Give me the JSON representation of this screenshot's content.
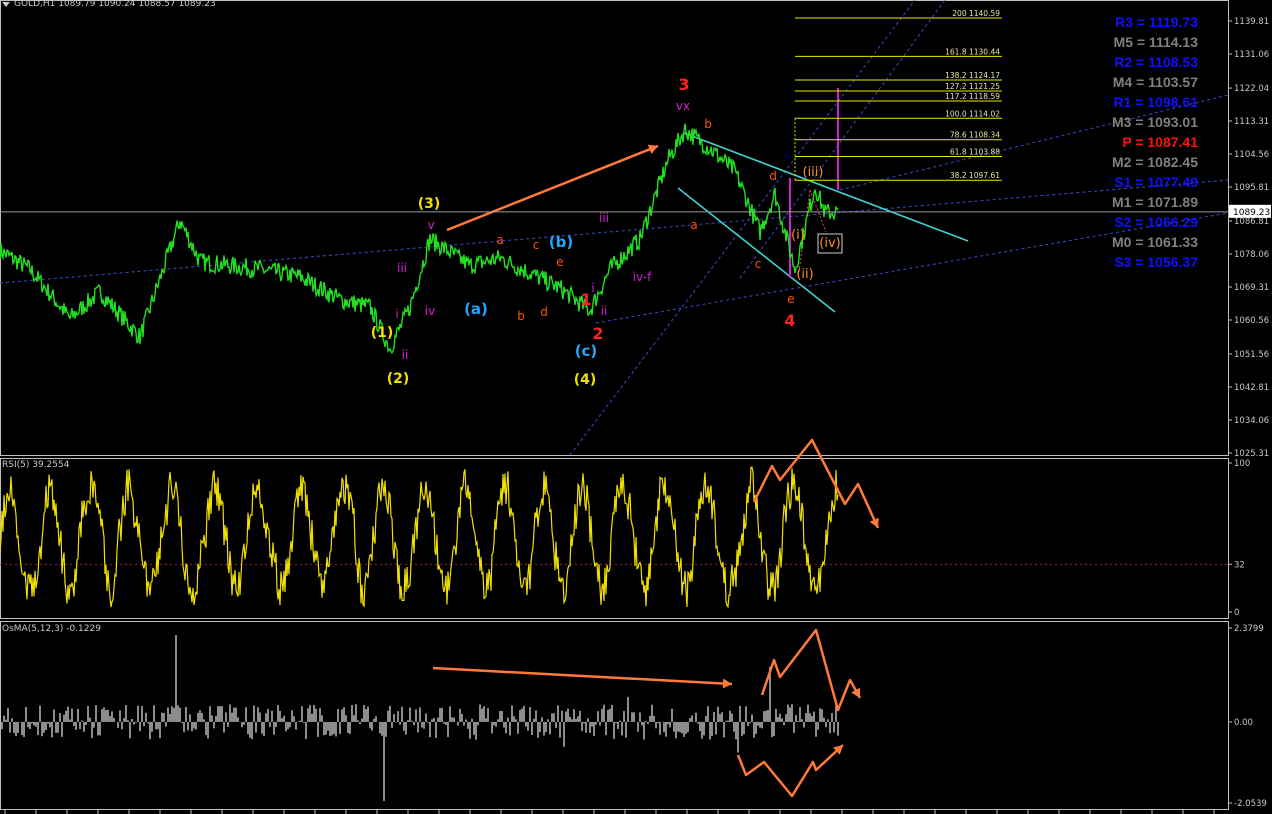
{
  "main_header": "GOLD,H1  1089.79 1090.24 1088.57 1089.23",
  "rsi_header": "RSI(5) 39.2554",
  "osma_header": "OsMA(5,12,3) -0.1229",
  "current_price_label": "1089.23",
  "pivots": [
    {
      "text": "R3 = 1119.73",
      "color": "#1010ff"
    },
    {
      "text": "M5 = 1114.13",
      "color": "#808080"
    },
    {
      "text": "R2 = 1108.53",
      "color": "#1010ff"
    },
    {
      "text": "M4 = 1103.57",
      "color": "#808080"
    },
    {
      "text": "R1 = 1098.61",
      "color": "#1010ff"
    },
    {
      "text": "M3 = 1093.01",
      "color": "#808080"
    },
    {
      "text": "P   = 1087.41",
      "color": "#ff1010"
    },
    {
      "text": "M2 = 1082.45",
      "color": "#808080"
    },
    {
      "text": "S1 = 1077.49",
      "color": "#1010ff"
    },
    {
      "text": "M1 = 1071.89",
      "color": "#808080"
    },
    {
      "text": "S2 = 1066.29",
      "color": "#1010ff"
    },
    {
      "text": "M0 = 1061.33",
      "color": "#808080"
    },
    {
      "text": "S3 = 1056.37",
      "color": "#1010ff"
    }
  ],
  "fib_levels": [
    {
      "ratio": "200",
      "price": 1140.59
    },
    {
      "ratio": "161.8",
      "price": 1130.44
    },
    {
      "ratio": "138.2",
      "price": 1124.17
    },
    {
      "ratio": "127.2",
      "price": 1121.25
    },
    {
      "ratio": "117.2",
      "price": 1118.59
    },
    {
      "ratio": "100.0",
      "price": 1114.02
    },
    {
      "ratio": "78.6",
      "price": 1108.34
    },
    {
      "ratio": "61.8",
      "price": 1103.88
    },
    {
      "ratio": "38.2",
      "price": 1097.61
    }
  ],
  "wave_labels": [
    {
      "text": "3",
      "color": "#ff2020"
    },
    {
      "text": "vx",
      "color": "#d020d0"
    },
    {
      "text": "b",
      "color": "#ff5010"
    },
    {
      "text": "a",
      "color": "#ff5010"
    },
    {
      "text": "d",
      "color": "#ff5010"
    },
    {
      "text": "c",
      "color": "#ff5010"
    },
    {
      "text": "e",
      "color": "#ff5010"
    },
    {
      "text": "4",
      "color": "#ff2020"
    },
    {
      "text": "(iii)",
      "color": "#ff8c20"
    },
    {
      "text": "(i)",
      "color": "#ff8c20"
    },
    {
      "text": "(ii)",
      "color": "#ff8c20"
    },
    {
      "text": "(iv)",
      "color": "#ff8c20"
    },
    {
      "text": "(3)",
      "color": "#f0e000"
    },
    {
      "text": "v",
      "color": "#d020d0"
    },
    {
      "text": "iii",
      "color": "#d020d0"
    },
    {
      "text": "i",
      "color": "#d020d0"
    },
    {
      "text": "iv",
      "color": "#d020d0"
    },
    {
      "text": "(1)",
      "color": "#f0e000"
    },
    {
      "text": "ii",
      "color": "#d020d0"
    },
    {
      "text": "(2)",
      "color": "#f0e000"
    },
    {
      "text": "a",
      "color": "#ff5010"
    },
    {
      "text": "c",
      "color": "#ff5010"
    },
    {
      "text": "(b)",
      "color": "#20a8ff"
    },
    {
      "text": "e",
      "color": "#ff5010"
    },
    {
      "text": "(a)",
      "color": "#20a8ff"
    },
    {
      "text": "b",
      "color": "#ff5010"
    },
    {
      "text": "d",
      "color": "#ff5010"
    },
    {
      "text": "1",
      "color": "#ff2020"
    },
    {
      "text": "2",
      "color": "#ff2020"
    },
    {
      "text": "(c)",
      "color": "#20a8ff"
    },
    {
      "text": "(4)",
      "color": "#f0e000"
    },
    {
      "text": "iii",
      "color": "#d020d0"
    },
    {
      "text": "i",
      "color": "#d020d0"
    },
    {
      "text": "ii",
      "color": "#d020d0"
    },
    {
      "text": "iv-f",
      "color": "#d020d0"
    }
  ],
  "chart_data": [
    {
      "type": "line",
      "name": "GOLD,H1",
      "symbol": "GOLD",
      "timeframe": "H1",
      "ohlc": {
        "open": 1089.79,
        "high": 1090.24,
        "low": 1088.57,
        "close": 1089.23
      },
      "y_ticks": [
        1139.81,
        1131.06,
        1122.04,
        1113.31,
        1104.56,
        1095.81,
        1086.81,
        1078.06,
        1069.31,
        1060.56,
        1051.56,
        1042.81,
        1034.06,
        1025.31
      ],
      "ylim": [
        1022,
        1144
      ],
      "approx_points": [
        {
          "x": 0,
          "y": 1079
        },
        {
          "x": 30,
          "y": 1074
        },
        {
          "x": 70,
          "y": 1061
        },
        {
          "x": 100,
          "y": 1068
        },
        {
          "x": 140,
          "y": 1056
        },
        {
          "x": 180,
          "y": 1087
        },
        {
          "x": 200,
          "y": 1076
        },
        {
          "x": 260,
          "y": 1074
        },
        {
          "x": 300,
          "y": 1072
        },
        {
          "x": 340,
          "y": 1066
        },
        {
          "x": 370,
          "y": 1064
        },
        {
          "x": 390,
          "y": 1053
        },
        {
          "x": 410,
          "y": 1064
        },
        {
          "x": 430,
          "y": 1082
        },
        {
          "x": 470,
          "y": 1075
        },
        {
          "x": 500,
          "y": 1077
        },
        {
          "x": 560,
          "y": 1069
        },
        {
          "x": 590,
          "y": 1063
        },
        {
          "x": 610,
          "y": 1074
        },
        {
          "x": 640,
          "y": 1082
        },
        {
          "x": 668,
          "y": 1103
        },
        {
          "x": 685,
          "y": 1111
        },
        {
          "x": 710,
          "y": 1106
        },
        {
          "x": 735,
          "y": 1100
        },
        {
          "x": 760,
          "y": 1084
        },
        {
          "x": 775,
          "y": 1094
        },
        {
          "x": 795,
          "y": 1074
        },
        {
          "x": 815,
          "y": 1096
        },
        {
          "x": 825,
          "y": 1089
        },
        {
          "x": 838,
          "y": 1089.23
        }
      ]
    },
    {
      "type": "line",
      "name": "RSI(5)",
      "last_value": 39.2554,
      "y_ticks": [
        100,
        32,
        0
      ],
      "ylim": [
        0,
        100
      ],
      "reference_line": 32
    },
    {
      "type": "bar",
      "name": "OsMA(5,12,3)",
      "last_value": -0.1229,
      "y_ticks": [
        2.3799,
        0.0,
        -2.0539
      ],
      "ylim": [
        -2.0539,
        2.3799
      ]
    }
  ]
}
